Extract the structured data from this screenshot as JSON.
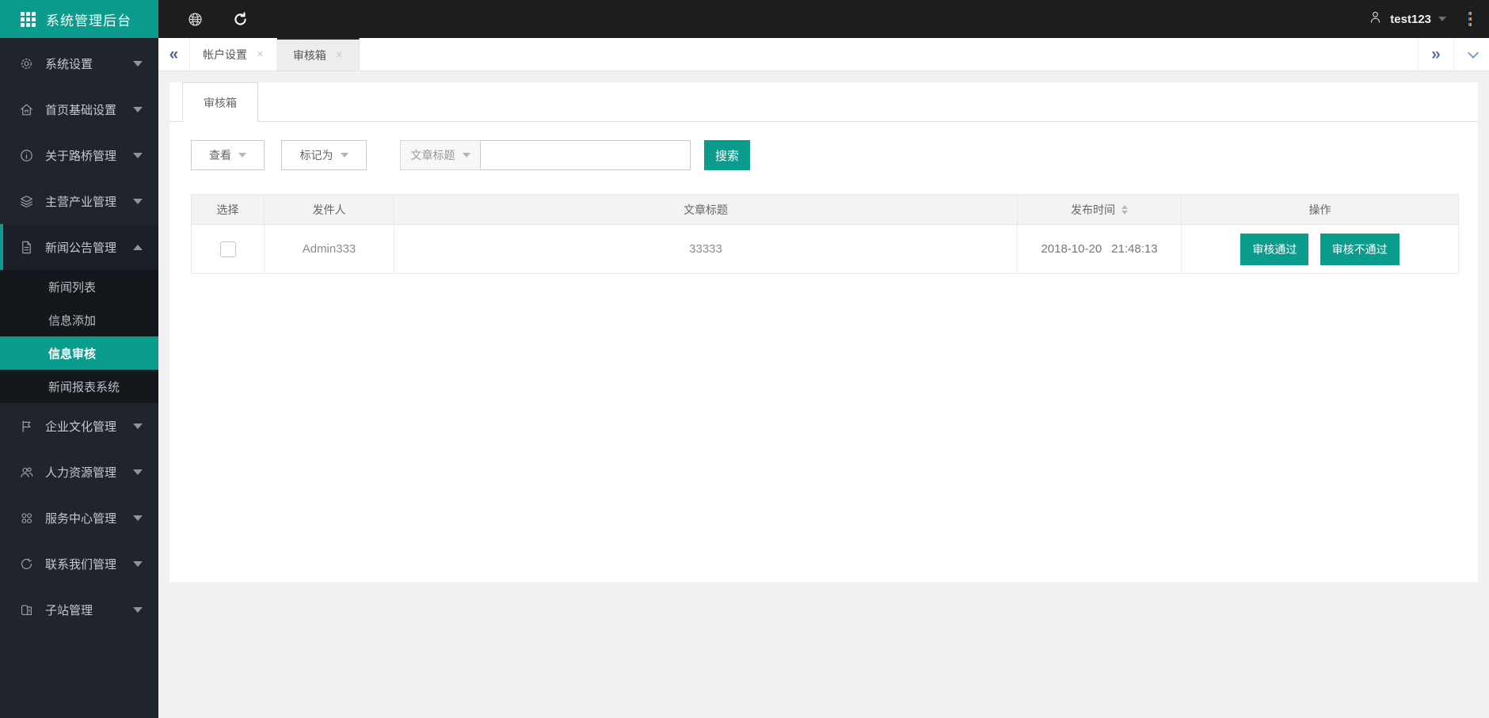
{
  "colors": {
    "accent": "#0b9c8d",
    "topbar_bg": "#1d1d1d",
    "sidebar_bg": "#20252d",
    "content_bg": "#f1f1f1"
  },
  "brand": {
    "title": "系统管理后台",
    "logo_icon": "grid-icon"
  },
  "topbar": {
    "icons": [
      "globe-icon",
      "refresh-icon"
    ],
    "username": "test123",
    "user_icon": "person-icon",
    "menu_icon": "kebab-menu-icon"
  },
  "tabbar": {
    "collapse_glyph": "«",
    "more_glyph": "»",
    "close_glyph": "×",
    "tabs": [
      {
        "label": "帐户设置",
        "active": false
      },
      {
        "label": "审核箱",
        "active": true
      }
    ]
  },
  "sidebar": {
    "items": [
      {
        "label": "系统设置",
        "icon": "gear-icon"
      },
      {
        "label": "首页基础设置",
        "icon": "home-icon"
      },
      {
        "label": "关于路桥管理",
        "icon": "info-icon"
      },
      {
        "label": "主营产业管理",
        "icon": "layers-icon"
      },
      {
        "label": "新闻公告管理",
        "icon": "document-icon",
        "expanded": true
      },
      {
        "label": "企业文化管理",
        "icon": "flag-icon"
      },
      {
        "label": "人力资源管理",
        "icon": "users-icon"
      },
      {
        "label": "服务中心管理",
        "icon": "command-icon"
      },
      {
        "label": "联系我们管理",
        "icon": "chat-icon"
      },
      {
        "label": "子站管理",
        "icon": "door-icon"
      }
    ],
    "submenu": {
      "parent": "新闻公告管理",
      "items": [
        {
          "label": "新闻列表",
          "active": false
        },
        {
          "label": "信息添加",
          "active": false
        },
        {
          "label": "信息审核",
          "active": true
        },
        {
          "label": "新闻报表系统",
          "active": false
        }
      ]
    }
  },
  "panel": {
    "tab_label": "审核箱"
  },
  "filters": {
    "view_label": "查看",
    "mark_label": "标记为",
    "field_label": "文章标题",
    "search_value": "",
    "search_button": "搜索"
  },
  "table": {
    "headers": [
      "选择",
      "发件人",
      "文章标题",
      "发布时间",
      "操作"
    ],
    "sorted_column": "发布时间",
    "rows": [
      {
        "checked": false,
        "sender": "Admin333",
        "title": "33333",
        "date": "2018-10-20",
        "time": "21:48:13",
        "approve_label": "审核通过",
        "reject_label": "审核不通过"
      }
    ]
  }
}
